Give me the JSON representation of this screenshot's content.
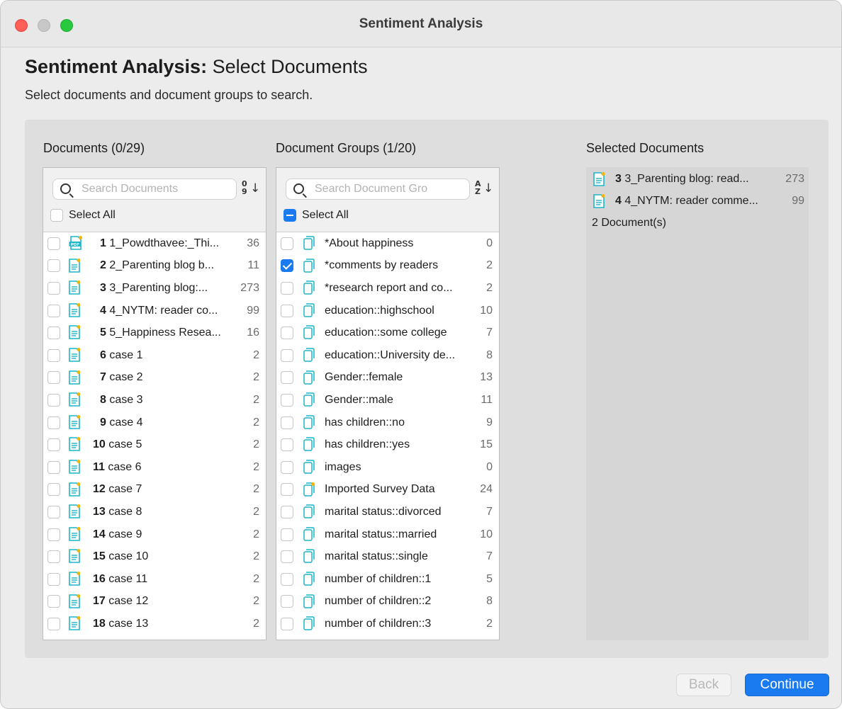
{
  "window": {
    "title": "Sentiment Analysis"
  },
  "header": {
    "title_bold": "Sentiment Analysis:",
    "title_rest": " Select Documents",
    "subtitle": "Select documents and document groups to search."
  },
  "documents": {
    "title": "Documents (0/29)",
    "search_placeholder": "Search Documents",
    "select_all": "Select All",
    "items": [
      {
        "num": "1",
        "name": "1_Powdthavee:_Thi...",
        "count": "36",
        "icon": "pdf-document-icon",
        "checked": false
      },
      {
        "num": "2",
        "name": "2_Parenting blog b...",
        "count": "11",
        "icon": "text-document-icon",
        "checked": false
      },
      {
        "num": "3",
        "name": "3_Parenting blog:...",
        "count": "273",
        "icon": "text-document-icon",
        "checked": false
      },
      {
        "num": "4",
        "name": "4_NYTM: reader co...",
        "count": "99",
        "icon": "text-document-icon",
        "checked": false
      },
      {
        "num": "5",
        "name": "5_Happiness Resea...",
        "count": "16",
        "icon": "text-document-icon",
        "checked": false
      },
      {
        "num": "6",
        "name": "case 1",
        "count": "2",
        "icon": "text-document-icon",
        "checked": false
      },
      {
        "num": "7",
        "name": "case 2",
        "count": "2",
        "icon": "text-document-icon",
        "checked": false
      },
      {
        "num": "8",
        "name": "case 3",
        "count": "2",
        "icon": "text-document-icon",
        "checked": false
      },
      {
        "num": "9",
        "name": "case 4",
        "count": "2",
        "icon": "text-document-icon",
        "checked": false
      },
      {
        "num": "10",
        "name": "case 5",
        "count": "2",
        "icon": "text-document-icon",
        "checked": false
      },
      {
        "num": "11",
        "name": "case 6",
        "count": "2",
        "icon": "text-document-icon",
        "checked": false
      },
      {
        "num": "12",
        "name": "case 7",
        "count": "2",
        "icon": "text-document-icon",
        "checked": false
      },
      {
        "num": "13",
        "name": "case 8",
        "count": "2",
        "icon": "text-document-icon",
        "checked": false
      },
      {
        "num": "14",
        "name": "case 9",
        "count": "2",
        "icon": "text-document-icon",
        "checked": false
      },
      {
        "num": "15",
        "name": "case 10",
        "count": "2",
        "icon": "text-document-icon",
        "checked": false
      },
      {
        "num": "16",
        "name": "case 11",
        "count": "2",
        "icon": "text-document-icon",
        "checked": false
      },
      {
        "num": "17",
        "name": "case 12",
        "count": "2",
        "icon": "text-document-icon",
        "checked": false
      },
      {
        "num": "18",
        "name": "case 13",
        "count": "2",
        "icon": "text-document-icon",
        "checked": false
      }
    ]
  },
  "groups": {
    "title": "Document Groups (1/20)",
    "search_placeholder": "Search Document Gro",
    "select_all": "Select All",
    "items": [
      {
        "name": "*About happiness",
        "count": "0",
        "checked": false,
        "dot": false
      },
      {
        "name": "*comments by readers",
        "count": "2",
        "checked": true,
        "dot": false
      },
      {
        "name": "*research report and co...",
        "count": "2",
        "checked": false,
        "dot": false
      },
      {
        "name": "education::highschool",
        "count": "10",
        "checked": false,
        "dot": false
      },
      {
        "name": "education::some college",
        "count": "7",
        "checked": false,
        "dot": false
      },
      {
        "name": "education::University de...",
        "count": "8",
        "checked": false,
        "dot": false
      },
      {
        "name": "Gender::female",
        "count": "13",
        "checked": false,
        "dot": false
      },
      {
        "name": "Gender::male",
        "count": "11",
        "checked": false,
        "dot": false
      },
      {
        "name": "has children::no",
        "count": "9",
        "checked": false,
        "dot": false
      },
      {
        "name": "has children::yes",
        "count": "15",
        "checked": false,
        "dot": false
      },
      {
        "name": "images",
        "count": "0",
        "checked": false,
        "dot": false
      },
      {
        "name": "Imported Survey Data",
        "count": "24",
        "checked": false,
        "dot": true
      },
      {
        "name": "marital status::divorced",
        "count": "7",
        "checked": false,
        "dot": false
      },
      {
        "name": "marital status::married",
        "count": "10",
        "checked": false,
        "dot": false
      },
      {
        "name": "marital status::single",
        "count": "7",
        "checked": false,
        "dot": false
      },
      {
        "name": "number of children::1",
        "count": "5",
        "checked": false,
        "dot": false
      },
      {
        "name": "number of children::2",
        "count": "8",
        "checked": false,
        "dot": false
      },
      {
        "name": "number of children::3",
        "count": "2",
        "checked": false,
        "dot": false
      }
    ]
  },
  "selected": {
    "title": "Selected Documents",
    "items": [
      {
        "num": "3",
        "name": "3_Parenting blog: read...",
        "count": "273"
      },
      {
        "num": "4",
        "name": "4_NYTM: reader comme...",
        "count": "99"
      }
    ],
    "footer": "2 Document(s)"
  },
  "buttons": {
    "back": "Back",
    "continue": "Continue"
  },
  "colors": {
    "accent": "#1a7bf0",
    "doc_icon": "#1bb6c8",
    "memo_dot": "#f5b400",
    "close": "#fe5f57",
    "zoom": "#28c840"
  }
}
